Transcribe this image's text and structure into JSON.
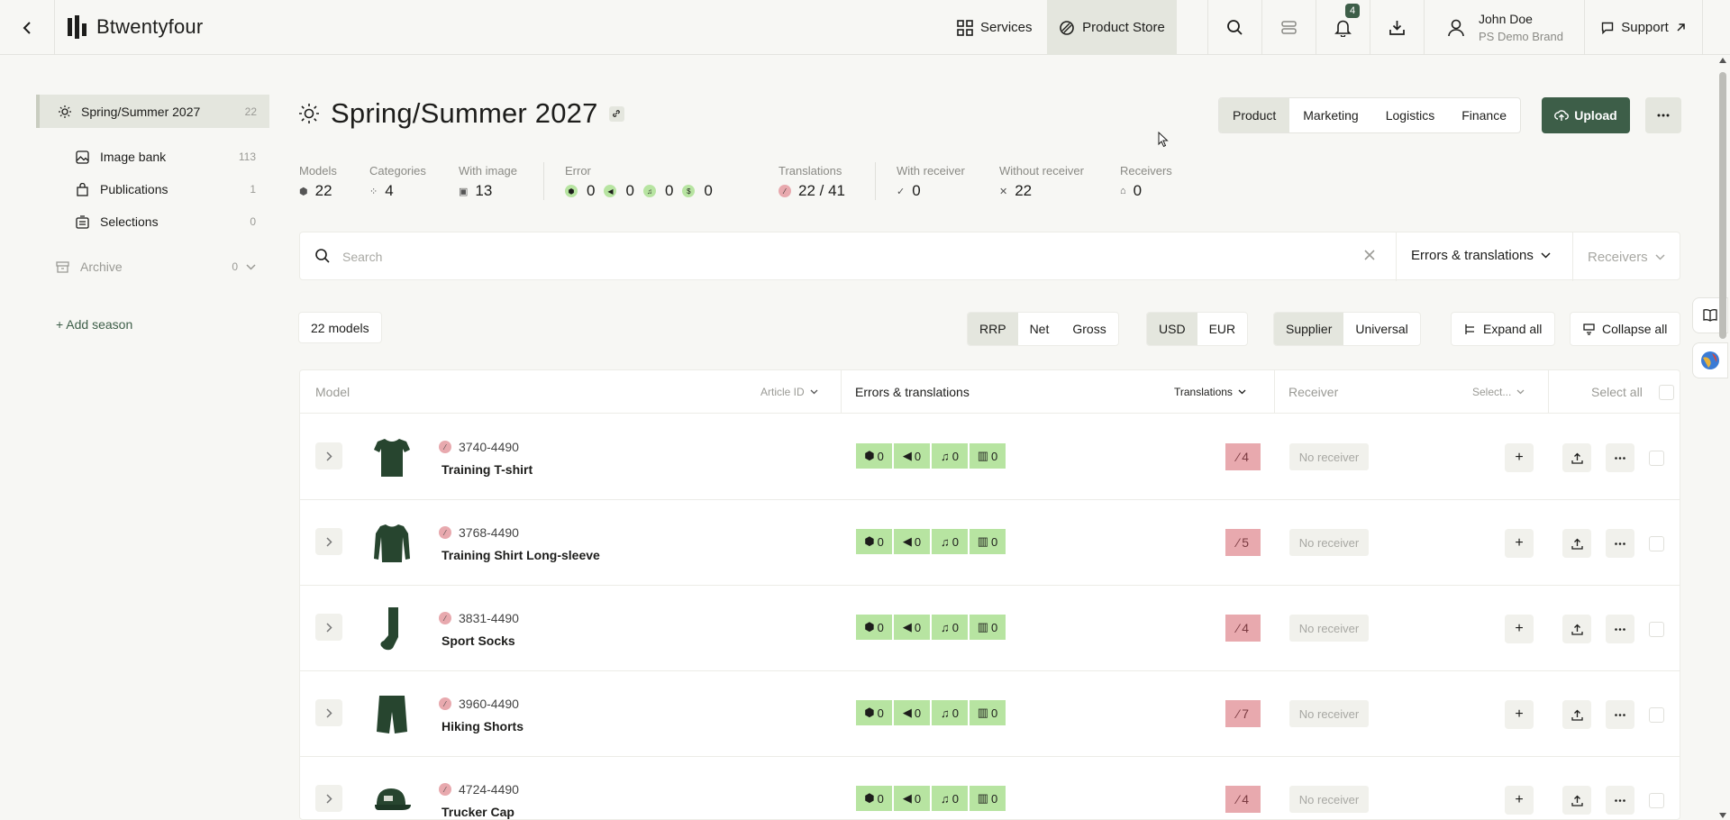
{
  "brand": {
    "name": "Btwentyfour"
  },
  "topnav": {
    "services": "Services",
    "product_store": "Product Store",
    "notifications_count": "4",
    "user_name": "John Doe",
    "user_brand": "PS Demo Brand",
    "support": "Support"
  },
  "sidebar": {
    "season": {
      "label": "Spring/Summer 2027",
      "count": "22"
    },
    "items": [
      {
        "label": "Image bank",
        "count": "113",
        "icon": "image-icon"
      },
      {
        "label": "Publications",
        "count": "1",
        "icon": "bag-icon"
      },
      {
        "label": "Selections",
        "count": "0",
        "icon": "list-icon"
      }
    ],
    "archive": {
      "label": "Archive",
      "count": "0"
    },
    "add_season": "+ Add season"
  },
  "header": {
    "title": "Spring/Summer 2027",
    "tabs": [
      "Product",
      "Marketing",
      "Logistics",
      "Finance"
    ],
    "active_tab": "Product",
    "upload": "Upload"
  },
  "stats": {
    "models": {
      "label": "Models",
      "value": "22"
    },
    "categories": {
      "label": "Categories",
      "value": "4"
    },
    "with_image": {
      "label": "With image",
      "value": "13"
    },
    "error": {
      "label": "Error",
      "values": [
        "0",
        "0",
        "0",
        "0"
      ]
    },
    "translations": {
      "label": "Translations",
      "value": "22 / 41"
    },
    "with_receiver": {
      "label": "With receiver",
      "value": "0"
    },
    "without_receiver": {
      "label": "Without receiver",
      "value": "22"
    },
    "receivers": {
      "label": "Receivers",
      "value": "0"
    }
  },
  "search": {
    "placeholder": "Search",
    "filter1": "Errors & translations",
    "filter2": "Receivers"
  },
  "toolbar": {
    "count": "22 models",
    "price_options": [
      "RRP",
      "Net",
      "Gross"
    ],
    "currency_options": [
      "USD",
      "EUR"
    ],
    "source_options": [
      "Supplier",
      "Universal"
    ],
    "expand_all": "Expand all",
    "collapse_all": "Collapse all"
  },
  "table": {
    "headers": {
      "model": "Model",
      "article_id": "Article ID",
      "errors": "Errors & translations",
      "translations": "Translations",
      "receiver": "Receiver",
      "select": "Select...",
      "select_all": "Select all"
    },
    "rows": [
      {
        "article_id": "3740-4490",
        "name": "Training T-shirt",
        "errors": [
          "0",
          "0",
          "0",
          "0"
        ],
        "translations": "4",
        "receiver": "No receiver",
        "icon": "tshirt-icon"
      },
      {
        "article_id": "3768-4490",
        "name": "Training Shirt Long-sleeve",
        "errors": [
          "0",
          "0",
          "0",
          "0"
        ],
        "translations": "5",
        "receiver": "No receiver",
        "icon": "longsleeve-icon"
      },
      {
        "article_id": "3831-4490",
        "name": "Sport Socks",
        "errors": [
          "0",
          "0",
          "0",
          "0"
        ],
        "translations": "4",
        "receiver": "No receiver",
        "icon": "sock-icon"
      },
      {
        "article_id": "3960-4490",
        "name": "Hiking Shorts",
        "errors": [
          "0",
          "0",
          "0",
          "0"
        ],
        "translations": "7",
        "receiver": "No receiver",
        "icon": "shorts-icon"
      },
      {
        "article_id": "4724-4490",
        "name": "Trucker Cap",
        "errors": [
          "0",
          "0",
          "0",
          "0"
        ],
        "translations": "4",
        "receiver": "No receiver",
        "icon": "cap-icon"
      }
    ]
  },
  "colors": {
    "accent": "#3d5e48",
    "error_ok": "#b7e4a1",
    "translation_missing": "#e8a9ae",
    "active_bg": "#e4e6de"
  }
}
